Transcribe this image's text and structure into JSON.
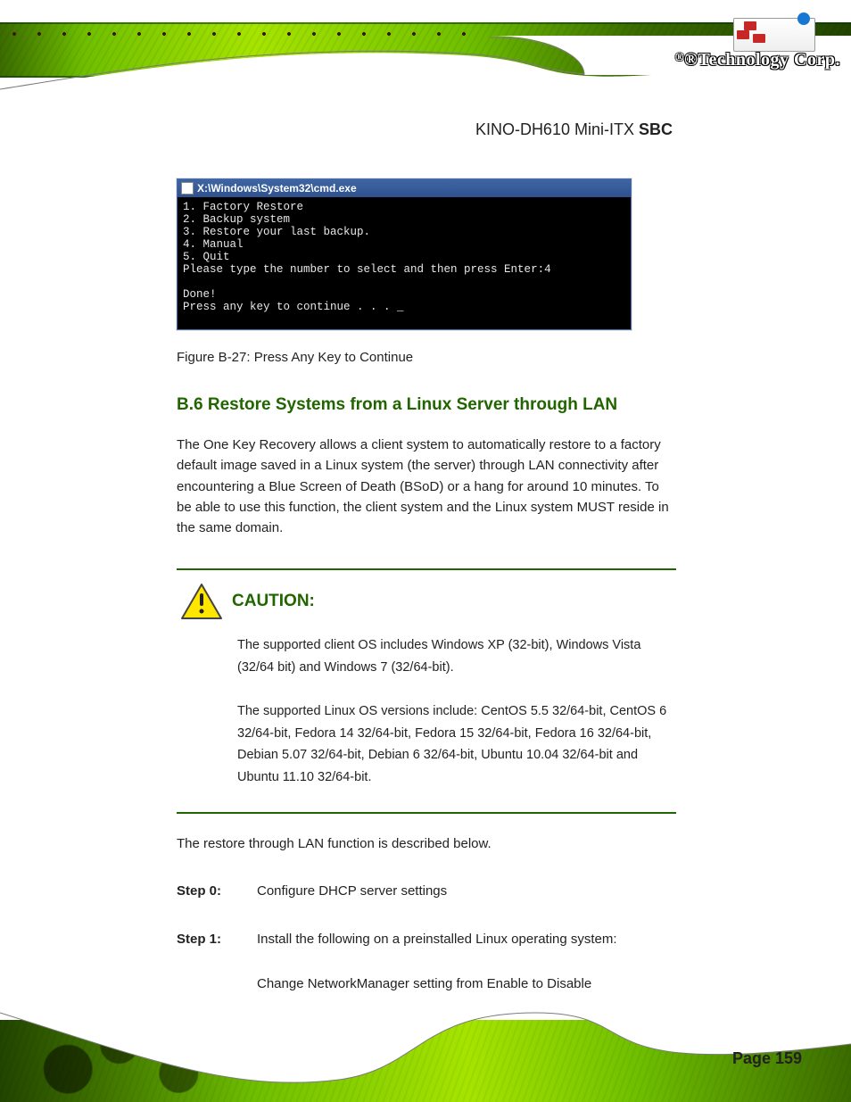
{
  "brand": {
    "text": "®Technology Corp."
  },
  "doc": {
    "title_prefix": "KINO-DH610 Mini-ITX ",
    "title_bold": "SBC"
  },
  "screenshot": {
    "titlebar": "X:\\Windows\\System32\\cmd.exe",
    "lines": "1. Factory Restore\n2. Backup system\n3. Restore your last backup.\n4. Manual\n5. Quit\nPlease type the number to select and then press Enter:4\n\nDone!\nPress any key to continue . . . _"
  },
  "figure": {
    "caption": "Figure B-27: Press Any Key to Continue"
  },
  "section": {
    "number": "B.6",
    "title": "Restore Systems from a Linux Server through LAN",
    "intro": "The One Key Recovery allows a client system to automatically restore to a factory default image saved in a Linux system (the server) through LAN connectivity after encountering a Blue Screen of Death (BSoD) or a hang for around 10 minutes. To be able to use this function, the client system and the Linux system MUST reside in the same domain."
  },
  "caution": {
    "label": "CAUTION:",
    "body": "The supported client OS includes Windows XP (32-bit), Windows Vista (32/64 bit) and Windows 7 (32/64-bit).\n\nThe supported Linux OS versions include: CentOS 5.5 32/64-bit, CentOS 6 32/64-bit, Fedora 14 32/64-bit, Fedora 15 32/64-bit, Fedora 16 32/64-bit, Debian 5.07 32/64-bit, Debian 6 32/64-bit, Ubuntu 10.04 32/64-bit and Ubuntu 11.10 32/64-bit."
  },
  "steps": {
    "intro": "The restore through LAN function is described below.",
    "s0": {
      "label": "Step 0:",
      "text": "Configure DHCP server settings"
    },
    "s1": {
      "label": "Step 1:",
      "text": "Install the following on a preinstalled Linux operating system:",
      "sub": "Change NetworkManager setting from Enable to Disable"
    }
  },
  "footer": {
    "page": "Page 159"
  }
}
